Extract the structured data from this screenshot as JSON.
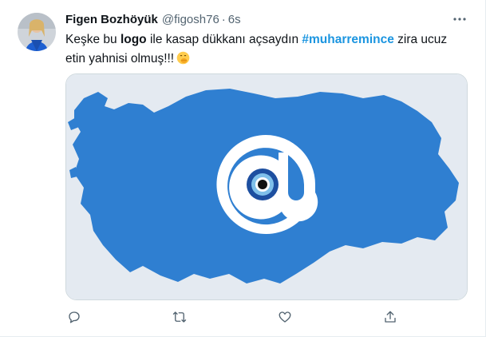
{
  "tweet": {
    "author": {
      "name": "Figen Bozhöyük",
      "handle": "@figosh76",
      "separator": "·",
      "time": "6s"
    },
    "text": {
      "part1": "Keşke bu ",
      "bold_word": "logo",
      "part2": " ile kasap dükkanı açsaydın ",
      "hashtag": "#muharremince",
      "part3": " zira ucuz etin yahnisi olmuş!!!"
    },
    "emoji": "face-with-hand-over-mouth",
    "media": {
      "description_icon": "turkey-map-at-sign-evil-eye"
    },
    "actions": [
      {
        "name": "reply-icon"
      },
      {
        "name": "retweet-icon"
      },
      {
        "name": "like-icon"
      },
      {
        "name": "share-icon"
      }
    ],
    "colors": {
      "accent": "#1b95e0",
      "secondary_text": "#536471",
      "map_blue": "#2f7fd1",
      "image_bg": "#e4eaf1"
    }
  }
}
